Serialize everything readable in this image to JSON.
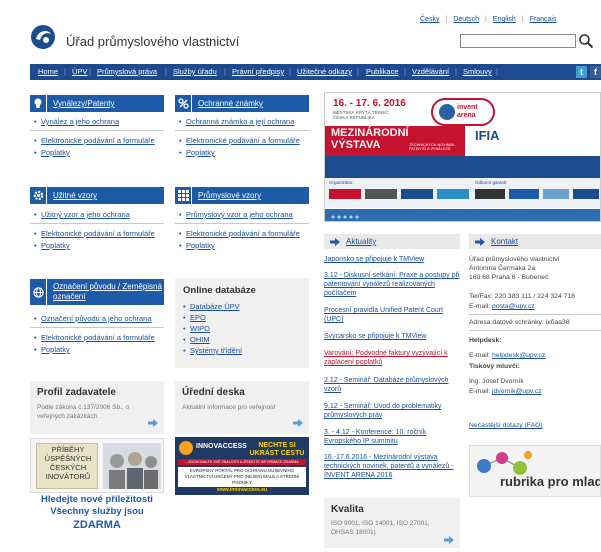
{
  "header": {
    "site_title": "Úřad průmyslového vlastnictví",
    "languages": [
      "Česky",
      "Deutsch",
      "English",
      "Français"
    ]
  },
  "nav": {
    "items": [
      "Home",
      "ÚPV",
      "Průmyslová práva",
      "Služby úřadu",
      "Právní předpisy",
      "Užitečné odkazy",
      "Publikace",
      "Vzdělávání",
      "Smlouvy"
    ]
  },
  "boxes": {
    "vynalezy": {
      "title": "Vynálezy/Patenty",
      "main_link": "Vynález a jeho ochrana",
      "links": [
        "Elektronické podávání a formuláře",
        "Poplatky"
      ]
    },
    "znamky": {
      "title": "Ochranné známky",
      "main_link": "Ochranná známka a její ochrana",
      "links": [
        "Elektronické podávání a formuláře",
        "Poplatky"
      ]
    },
    "uzitne": {
      "title": "Užitné vzory",
      "main_link": "Užitný vzor a jeho ochrana",
      "links": [
        "Elektronické podávání a formuláře",
        "Poplatky"
      ]
    },
    "prumyslove": {
      "title": "Průmyslové vzory",
      "main_link": "Průmyslový vzor a jeho ochrana",
      "links": [
        "Elektronické podávání a formuláře",
        "Poplatky"
      ]
    },
    "oznaceni": {
      "title_line1": "Označení původu / Zeměpisná",
      "title_line2": "označení",
      "main_link": "Označení původu a jeho ochrana",
      "links": [
        "Elektronické podávání a formuláře",
        "Poplatky"
      ]
    }
  },
  "online_db": {
    "title": "Online databáze",
    "links": [
      "Databáze ÚPV",
      "EPO",
      "WIPO",
      "OHIM",
      "Systémy třídění"
    ]
  },
  "profil": {
    "title": "Profil zadavatele",
    "text": "Podle zákona č.137/2006 Sb., o veřejných zakázkách."
  },
  "deska": {
    "title": "Úřední deska",
    "text": "Aktuální informace pro veřejnost"
  },
  "pribehy": {
    "lines": [
      "PŘÍBĚHY",
      "ÚSPĚŠNÝCH",
      "ČESKÝCH",
      "INOVÁTORŮ"
    ]
  },
  "innovaccess": {
    "logo": "INNOVACCESS",
    "slogan_l1": "NECHTE SI",
    "slogan_l2": "UKRÁST CESTU",
    "sub": "...ZDOKONALTE SVÉ ZNALOSTI A ZÍSKEJTE INFORMACE ZDARMA",
    "desc": "EVROPSKÝ PORTÁL PRO OCHRANU DUŠEVNÍHO VLASTNICTVÍ URČENÝ PRO (NEJEN) MALÉ A STŘEDNÍ PODNIKY",
    "url": "www.innovaccess.eu"
  },
  "promo": {
    "line1": "Hledejte nové příležitosti",
    "line2": "Všechny služby jsou",
    "line3": "ZDARMA"
  },
  "banner": {
    "date": "16. - 17. 6. 2016",
    "venue": "MĚSTSKÁ KRYTÁ TŘINEC",
    "country": "ČESKÁ REPUBLIKA",
    "title1": "MEZINÁRODNÍ",
    "title2": "VÝSTAVA",
    "subtitle": "TECHNICKÝCH NOVINEK, PATENTŮ A VYNÁLEZŮ",
    "brand": "invent arena",
    "ifia": "IFIA",
    "organizer": "Organizátor:",
    "partners": "Odborní garanti:"
  },
  "aktuality": {
    "title": "Aktuality",
    "items": [
      "Japonsko se připojuje k TMView",
      "3.12 - Diskusní setkání: Praxe a postupy při patentování vynálezů realizovaných počítačem",
      "Procesní pravidla Unified Patent Court (UPC)",
      "Švýcarsko se připojuje k TMView",
      "Varování: Podvodné faktury vyzývající k zaplacení poplatků",
      "2.12 - Seminář: Databáze průmyslových vzorů",
      "9.12 - Seminář: Úvod do problematiky průmyslových práv",
      "3. - 4.12 - Konference: 10. ročník Evropského IP summitu",
      "16.-17.6.2016 - Mezinárodní výstava technických novinek, patentů a vynálezů - INVENT ARENA 2016"
    ]
  },
  "kontakt": {
    "title": "Kontakt",
    "address": [
      "Úřad průmyslového vlastnictví",
      "Antonína Čermáka 2a",
      "160 68 Praha 6 - Bubeneč"
    ],
    "telfax": "Tel/Fax: 220 383 111 / 224 324 718",
    "email_label": "E-mail:",
    "email": "posta@upv.cz",
    "datova": "Adresa datové schránky: ixбaa38",
    "helpdesk_title": "Helpdesk:",
    "helpdesk_email": "helpdesk@upv.cz",
    "tiskovy_title": "Tiskový mluvčí:",
    "mluvci": "Ing. Josef Dvorník",
    "mluvci_email": "jdvornik@upv.cz",
    "faq": "Nečastější dotazy (FAQ)"
  },
  "kvalita": {
    "title": "Kvalita",
    "text": "ISO 9001, ISO 14001, ISO 27001, OHSAS 18001)"
  },
  "rubrika": {
    "text": "rubrika pro mlade"
  },
  "colors": {
    "navy": "#1d4b8f",
    "blue": "#1d5aa8",
    "red": "#c4122f"
  }
}
